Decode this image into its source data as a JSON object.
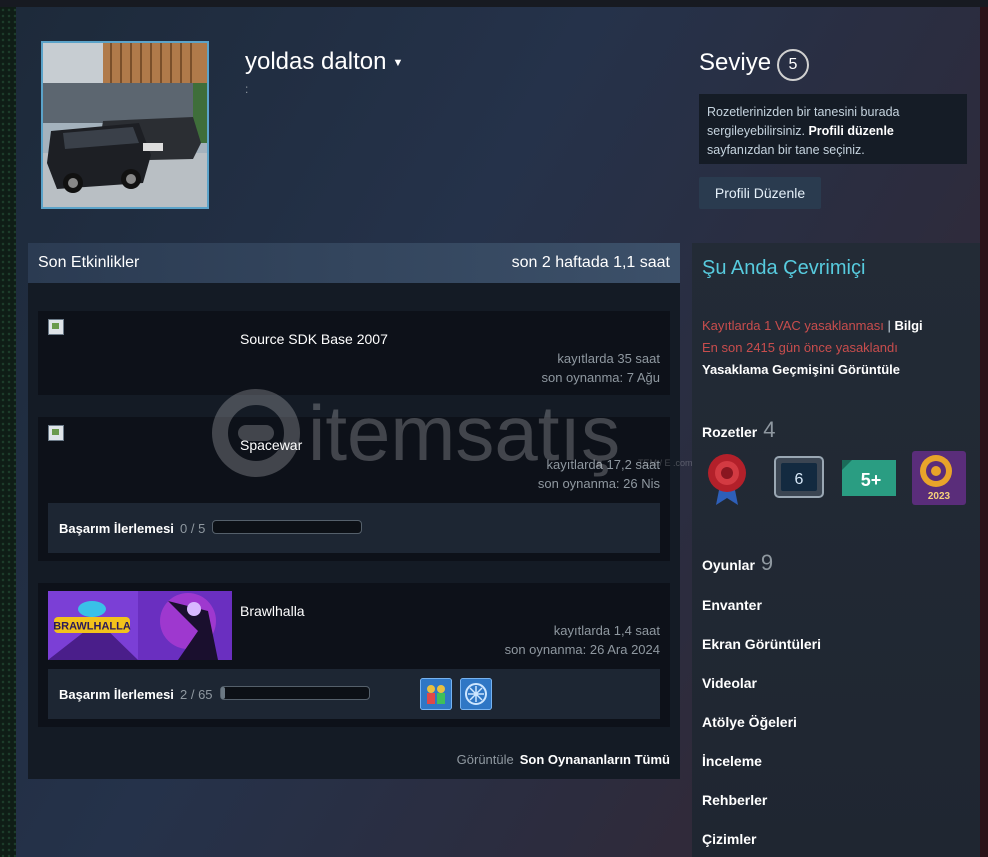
{
  "profile": {
    "username": "yoldas dalton",
    "subtext": ":",
    "level_label": "Seviye",
    "level": "5",
    "badge_text_1": "Rozetlerinizden bir tanesini burada sergileyebilirsiniz.",
    "badge_text_link": "Profili düzenle",
    "badge_text_2": "sayfanızdan bir tane seçiniz.",
    "edit_button": "Profili Düzenle"
  },
  "activity": {
    "title": "Son Etkinlikler",
    "summary": "son 2 haftada 1,1 saat",
    "games": [
      {
        "name": "Source SDK Base 2007",
        "hours": "kayıtlarda 35 saat",
        "last_played": "son oynanma: 7 Ağu"
      },
      {
        "name": "Spacewar",
        "hours": "kayıtlarda 17,2 saat",
        "last_played": "son oynanma: 26 Nis",
        "ach_label": "Başarım İlerlemesi",
        "ach_count": "0 / 5",
        "ach_progress": 0
      },
      {
        "name": "Brawlhalla",
        "hours": "kayıtlarda 1,4 saat",
        "last_played": "son oynanma: 26 Ara 2024",
        "ach_label": "Başarım İlerlemesi",
        "ach_count": "2 / 65",
        "ach_progress": 0.03
      }
    ],
    "view_label": "Görüntüle",
    "view_link": "Son Oynananların Tümü"
  },
  "sidebar": {
    "status": "Şu Anda Çevrimiçi",
    "vac_text": "Kayıtlarda 1 VAC yasaklanması",
    "vac_sep": "|",
    "vac_info": "Bilgi",
    "vac_since": "En son 2415 gün önce yasaklandı",
    "vac_history": "Yasaklama Geçmişini Görüntüle",
    "badges_label": "Rozetler",
    "badges_count": "4",
    "badge_6": "6",
    "badge_5plus": "5+",
    "badge_2023": "2023",
    "games_label": "Oyunlar",
    "games_count": "9",
    "links": [
      "Envanter",
      "Ekran Görüntüleri",
      "Videolar",
      "Atölye Öğeleri",
      "İnceleme",
      "Rehberler",
      "Çizimler"
    ]
  },
  "brawlhalla_banner": "BRAWLHALLA",
  "watermark": {
    "text": "itemsatış",
    "sub": "TEM / E   .com"
  },
  "colors": {
    "accent_online": "#57cbde",
    "vac_red": "#c84d4d",
    "header_blue": "#3c5069"
  }
}
